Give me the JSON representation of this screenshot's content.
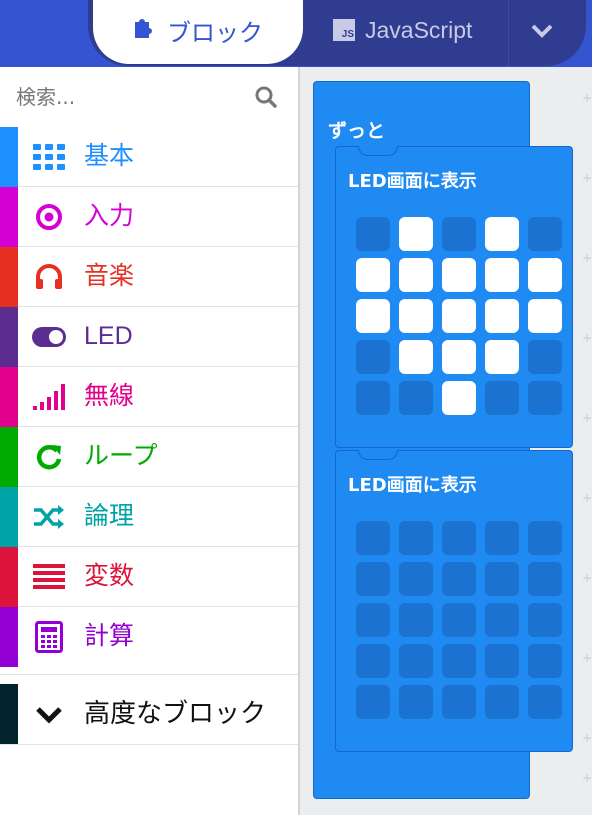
{
  "header": {
    "tabs": [
      {
        "label": "ブロック",
        "icon": "puzzle-icon",
        "active": true
      },
      {
        "label": "JavaScript",
        "icon": "js-icon",
        "active": false
      }
    ],
    "js_badge": "JS",
    "more_icon": "chevron-down-icon",
    "colors": {
      "bar": "#3454d1",
      "group": "#2f3c8f"
    }
  },
  "toolbox": {
    "search": {
      "placeholder": "検索...",
      "icon": "search-icon"
    },
    "categories": [
      {
        "label": "基本",
        "color": "#1e90ff",
        "icon": "grid-icon"
      },
      {
        "label": "入力",
        "color": "#d400d4",
        "icon": "target-icon"
      },
      {
        "label": "音楽",
        "color": "#e63022",
        "icon": "headphones-icon"
      },
      {
        "label": "LED",
        "color": "#5c2d91",
        "icon": "toggle-icon"
      },
      {
        "label": "無線",
        "color": "#e3008c",
        "icon": "signal-icon"
      },
      {
        "label": "ループ",
        "color": "#00aa00",
        "icon": "refresh-icon"
      },
      {
        "label": "論理",
        "color": "#00a4a6",
        "icon": "shuffle-icon"
      },
      {
        "label": "変数",
        "color": "#dc143c",
        "icon": "list-icon"
      },
      {
        "label": "計算",
        "color": "#9400d3",
        "icon": "calculator-icon"
      }
    ],
    "advanced": {
      "label": "高度なブロック",
      "icon": "chevron-down-icon"
    }
  },
  "workspace": {
    "forever": {
      "label": "ずっと"
    },
    "led_blocks": [
      {
        "label": "LED画面に表示",
        "grid": [
          [
            0,
            1,
            0,
            1,
            0
          ],
          [
            1,
            1,
            1,
            1,
            1
          ],
          [
            1,
            1,
            1,
            1,
            1
          ],
          [
            0,
            1,
            1,
            1,
            0
          ],
          [
            0,
            0,
            1,
            0,
            0
          ]
        ]
      },
      {
        "label": "LED画面に表示",
        "grid": [
          [
            0,
            0,
            0,
            0,
            0
          ],
          [
            0,
            0,
            0,
            0,
            0
          ],
          [
            0,
            0,
            0,
            0,
            0
          ],
          [
            0,
            0,
            0,
            0,
            0
          ],
          [
            0,
            0,
            0,
            0,
            0
          ]
        ]
      }
    ]
  }
}
